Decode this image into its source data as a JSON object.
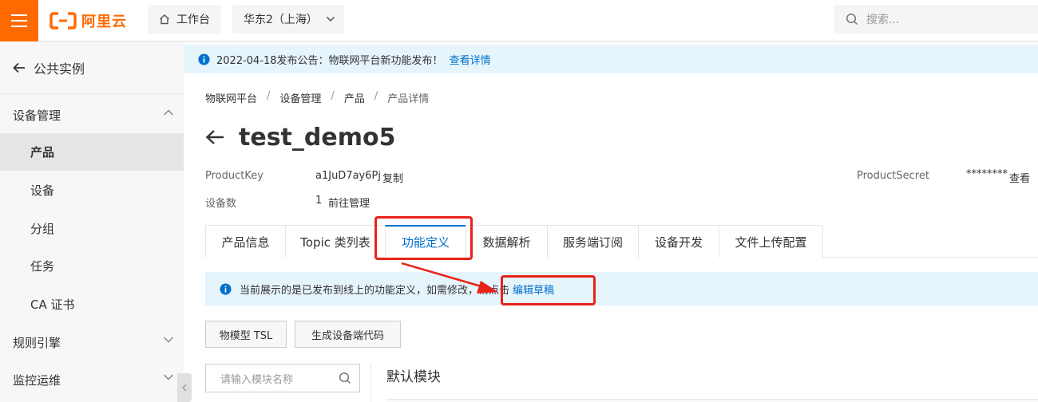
{
  "topbar": {
    "logo_text": "阿里云",
    "console_label": "工作台",
    "region_label": "华东2（上海）",
    "search_placeholder": "搜索..."
  },
  "sidebar": {
    "back_label": "公共实例",
    "groups": [
      {
        "label": "设备管理",
        "expanded": true
      },
      {
        "label": "规则引擎",
        "expanded": false
      },
      {
        "label": "监控运维",
        "expanded": false
      }
    ],
    "items": [
      {
        "label": "产品",
        "active": true
      },
      {
        "label": "设备"
      },
      {
        "label": "分组"
      },
      {
        "label": "任务"
      },
      {
        "label": "CA 证书"
      }
    ]
  },
  "notice": {
    "text": "2022-04-18发布公告：物联网平台新功能发布！",
    "link": "查看详情"
  },
  "breadcrumb": [
    "物联网平台",
    "设备管理",
    "产品",
    "产品详情"
  ],
  "product": {
    "title": "test_demo5",
    "product_key_label": "ProductKey",
    "product_key": "a1JuD7ay6Pj",
    "copy_link": "复制",
    "device_count_label": "设备数",
    "device_count": "1",
    "manage_link": "前往管理",
    "secret_label": "ProductSecret",
    "secret_value": "********",
    "view_link": "查看"
  },
  "tabs": [
    {
      "label": "产品信息"
    },
    {
      "label": "Topic 类列表"
    },
    {
      "label": "功能定义",
      "active": true
    },
    {
      "label": "数据解析"
    },
    {
      "label": "服务端订阅"
    },
    {
      "label": "设备开发"
    },
    {
      "label": "文件上传配置"
    }
  ],
  "info_bar": {
    "text": "当前展示的是已发布到线上的功能定义，如需修改，请点击",
    "link": "编辑草稿"
  },
  "actions": {
    "tsl_label": "物模型 TSL",
    "gen_code_label": "生成设备端代码"
  },
  "module": {
    "search_placeholder": "请输入模块名称",
    "title": "默认模块"
  },
  "colors": {
    "brand": "#ff6a00",
    "link": "#0070cc",
    "annotation": "#e8231a",
    "info_bg": "#e6f4fc"
  }
}
